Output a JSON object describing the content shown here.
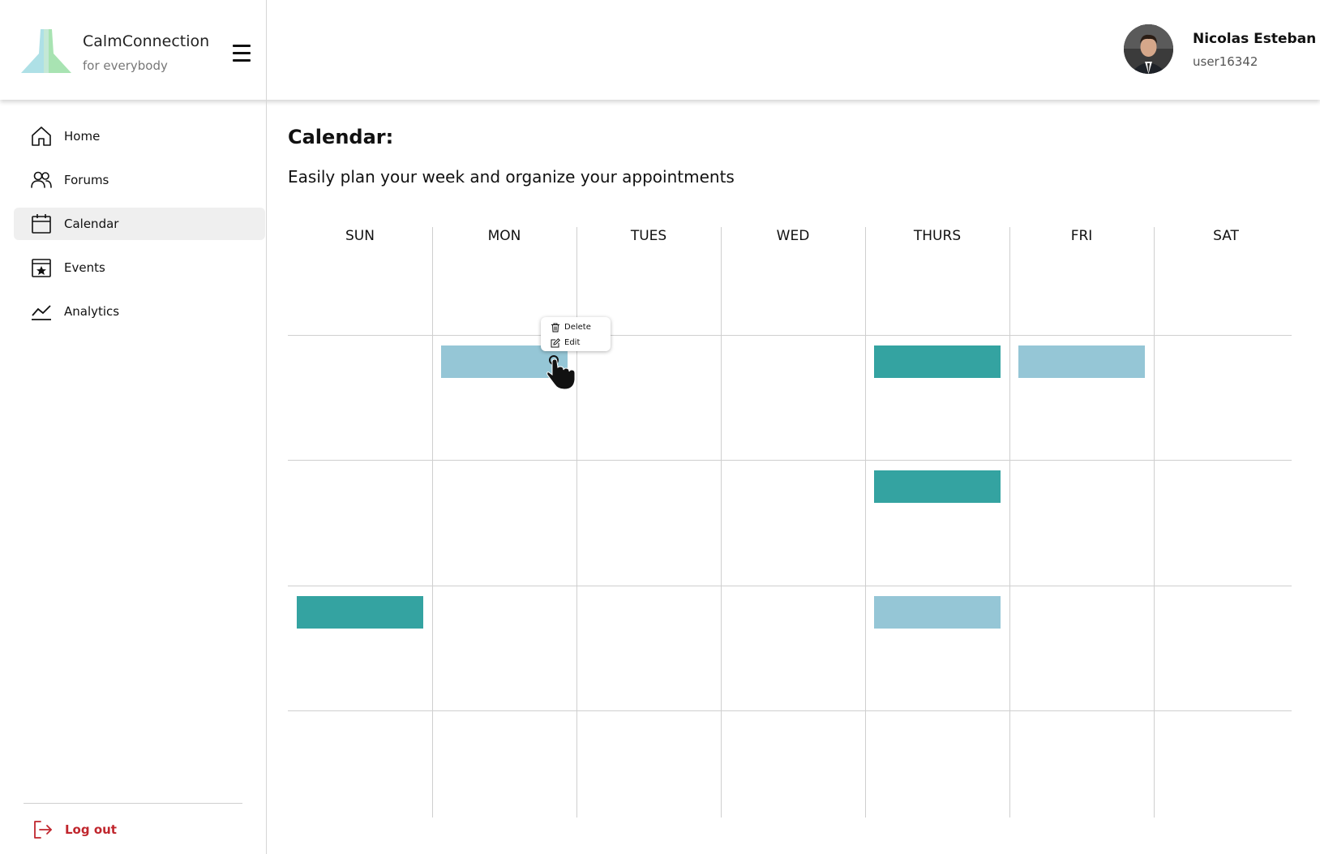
{
  "brand": {
    "name": "CalmConnection",
    "tagline": "for everybody"
  },
  "user": {
    "name": "Nicolas Esteban",
    "username": "user16342"
  },
  "sidebar": {
    "items": [
      {
        "label": "Home",
        "icon": "home-icon",
        "active": false
      },
      {
        "label": "Forums",
        "icon": "users-icon",
        "active": false
      },
      {
        "label": "Calendar",
        "icon": "calendar-icon",
        "active": true
      },
      {
        "label": "Events",
        "icon": "star-calendar-icon",
        "active": false
      },
      {
        "label": "Analytics",
        "icon": "chart-line-icon",
        "active": false
      }
    ],
    "logout_label": "Log out"
  },
  "page": {
    "title": "Calendar:",
    "subtitle": "Easily plan your week and organize your appointments"
  },
  "calendar": {
    "days": [
      "SUN",
      "MON",
      "TUES",
      "WED",
      "THURS",
      "FRI",
      "SAT"
    ],
    "events": [
      {
        "day": "MON",
        "row": 1,
        "color": "light"
      },
      {
        "day": "THURS",
        "row": 1,
        "color": "teal"
      },
      {
        "day": "FRI",
        "row": 1,
        "color": "light"
      },
      {
        "day": "THURS",
        "row": 2,
        "color": "teal"
      },
      {
        "day": "SUN",
        "row": 3,
        "color": "teal"
      },
      {
        "day": "THURS",
        "row": 3,
        "color": "light"
      }
    ]
  },
  "context_menu": {
    "delete_label": "Delete",
    "edit_label": "Edit"
  },
  "colors": {
    "accent_teal": "#34a3a1",
    "accent_light": "#95c6d6",
    "logout_red": "#c0262d",
    "active_bg": "#efefef"
  }
}
